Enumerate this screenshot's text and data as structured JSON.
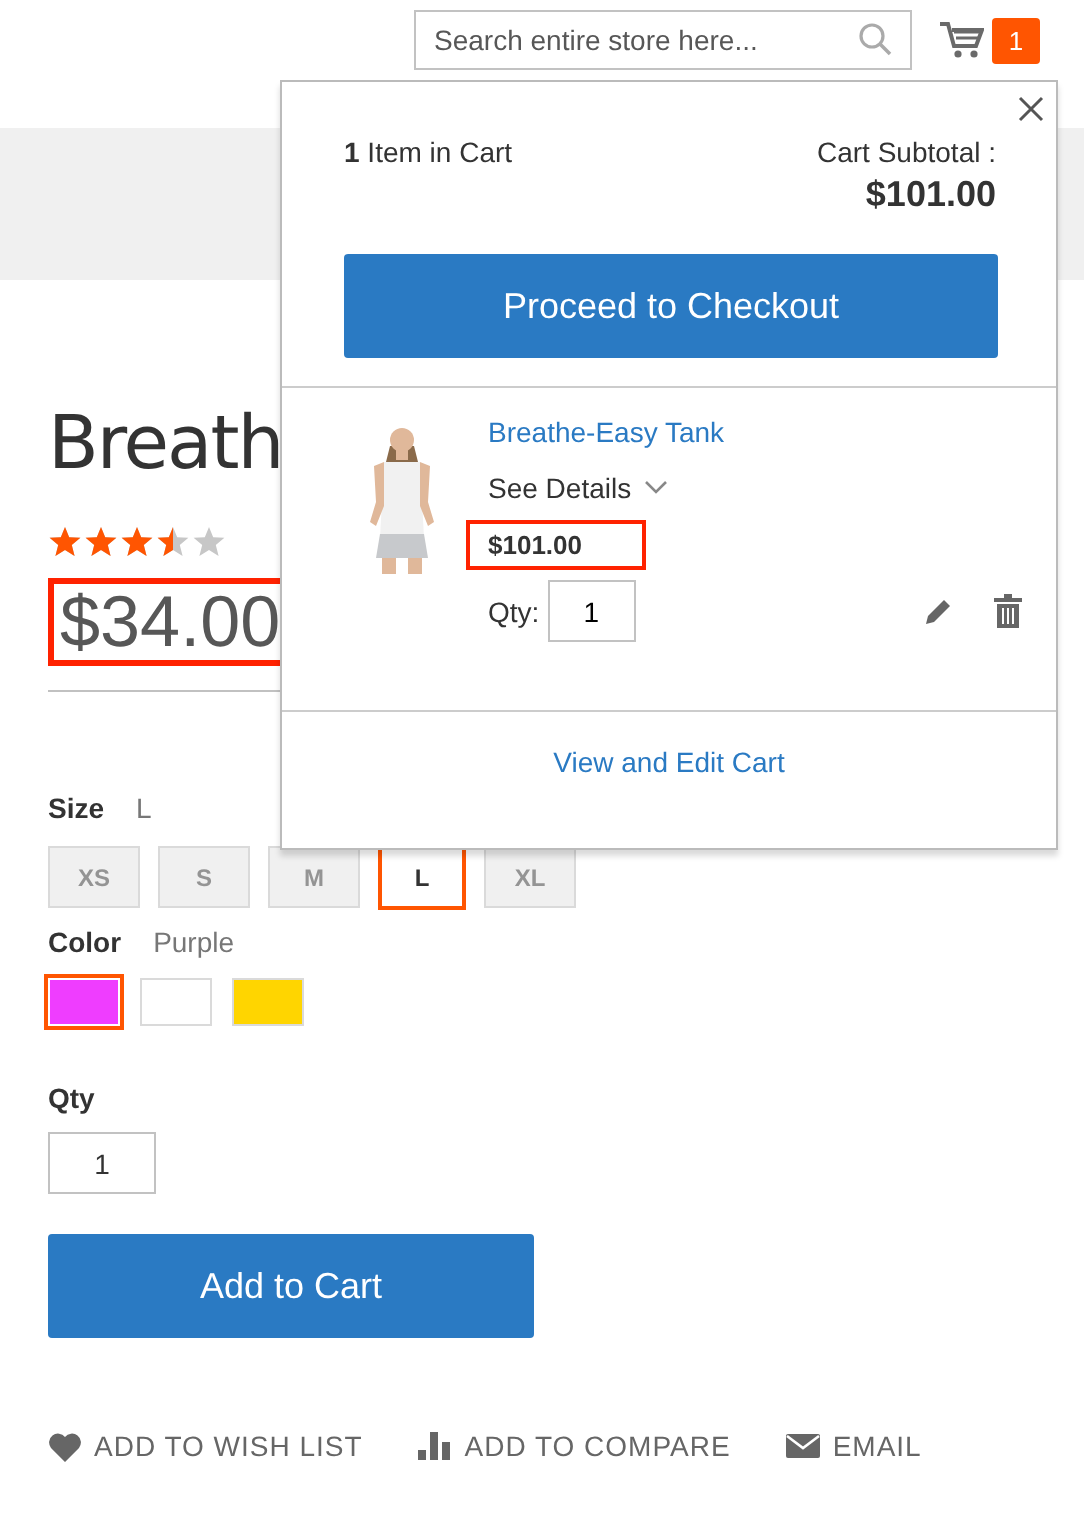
{
  "header": {
    "search": {
      "placeholder": "Search entire store here..."
    },
    "cart_count": "1"
  },
  "product": {
    "title": "Breath",
    "stars": 3.5,
    "price": "$34.00",
    "price_highlighted": true,
    "size": {
      "label": "Size",
      "value": "L",
      "options": [
        {
          "label": "XS",
          "selected": false
        },
        {
          "label": "S",
          "selected": false
        },
        {
          "label": "M",
          "selected": false
        },
        {
          "label": "L",
          "selected": true
        },
        {
          "label": "XL",
          "selected": false
        }
      ]
    },
    "color": {
      "label": "Color",
      "value": "Purple",
      "options": [
        {
          "color": "#ef3dff",
          "selected": true
        },
        {
          "color": "#ffffff",
          "selected": false
        },
        {
          "color": "#ffd500",
          "selected": false
        }
      ]
    },
    "qty": {
      "label": "Qty",
      "value": "1"
    },
    "add_button": "Add to Cart",
    "links": [
      {
        "kind": "wishlist",
        "label": "ADD TO WISH LIST"
      },
      {
        "kind": "compare",
        "label": "ADD TO COMPARE"
      },
      {
        "kind": "email",
        "label": "EMAIL"
      }
    ]
  },
  "minicart": {
    "items_text": "**1** Item in Cart",
    "subtotal_label": "Cart Subtotal :",
    "subtotal": "$101.00",
    "checkout_button": "Proceed to Checkout",
    "item": {
      "name": "Breathe-Easy Tank",
      "details": "See Details",
      "price": "$101.00",
      "price_highlighted": true,
      "qty_label": "Qty:",
      "qty": "1"
    },
    "view_cart": "View and Edit Cart"
  }
}
